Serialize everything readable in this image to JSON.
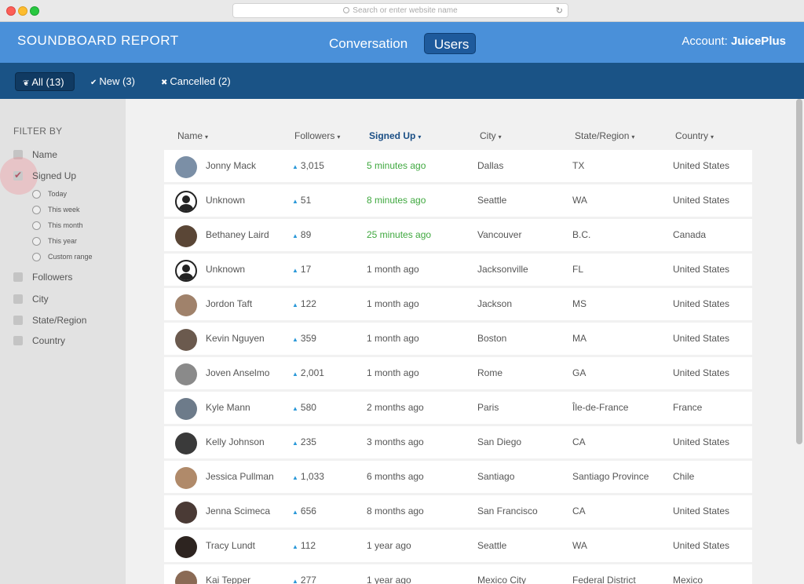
{
  "browser": {
    "url_placeholder": "Search or enter website name"
  },
  "app": {
    "logo": "SOUNDBOARD REPORT",
    "nav": {
      "conversation": "Conversation",
      "users": "Users"
    },
    "account_prefix": "Account:",
    "account_name": "JuicePlus"
  },
  "subnav": {
    "all": "All (13)",
    "new": "New (3)",
    "cancelled": "Cancelled (2)"
  },
  "sidebar": {
    "title": "FILTER BY",
    "filters": {
      "name": "Name",
      "signed_up": "Signed Up",
      "followers": "Followers",
      "city": "City",
      "state": "State/Region",
      "country": "Country"
    },
    "signed_up_options": [
      "Today",
      "This week",
      "This month",
      "This year",
      "Custom range"
    ]
  },
  "table": {
    "headers": {
      "name": "Name",
      "followers": "Followers",
      "signed_up": "Signed Up",
      "city": "City",
      "state": "State/Region",
      "country": "Country"
    },
    "rows": [
      {
        "name": "Jonny Mack",
        "followers": "3,015",
        "signed_up": "5 minutes ago",
        "city": "Dallas",
        "state": "TX",
        "country": "United States"
      },
      {
        "name": "Unknown",
        "followers": "51",
        "signed_up": "8 minutes ago",
        "city": "Seattle",
        "state": "WA",
        "country": "United States"
      },
      {
        "name": "Bethaney Laird",
        "followers": "89",
        "signed_up": "25 minutes ago",
        "city": "Vancouver",
        "state": "B.C.",
        "country": "Canada"
      },
      {
        "name": "Unknown",
        "followers": "17",
        "signed_up": "1 month ago",
        "city": "Jacksonville",
        "state": "FL",
        "country": "United States"
      },
      {
        "name": "Jordon Taft",
        "followers": "122",
        "signed_up": "1 month ago",
        "city": "Jackson",
        "state": "MS",
        "country": "United States"
      },
      {
        "name": "Kevin Nguyen",
        "followers": "359",
        "signed_up": "1 month ago",
        "city": "Boston",
        "state": "MA",
        "country": "United States"
      },
      {
        "name": "Joven Anselmo",
        "followers": "2,001",
        "signed_up": "1 month ago",
        "city": "Rome",
        "state": "GA",
        "country": "United States"
      },
      {
        "name": "Kyle Mann",
        "followers": "580",
        "signed_up": "2 months ago",
        "city": "Paris",
        "state": "Île-de-France",
        "country": "France"
      },
      {
        "name": "Kelly Johnson",
        "followers": "235",
        "signed_up": "3 months ago",
        "city": "San Diego",
        "state": "CA",
        "country": "United States"
      },
      {
        "name": "Jessica Pullman",
        "followers": "1,033",
        "signed_up": "6 months ago",
        "city": "Santiago",
        "state": "Santiago Province",
        "country": "Chile"
      },
      {
        "name": "Jenna Scimeca",
        "followers": "656",
        "signed_up": "8 months ago",
        "city": "San Francisco",
        "state": "CA",
        "country": "United States"
      },
      {
        "name": "Tracy Lundt",
        "followers": "112",
        "signed_up": "1 year ago",
        "city": "Seattle",
        "state": "WA",
        "country": "United States"
      },
      {
        "name": "Kai Tepper",
        "followers": "277",
        "signed_up": "1 year ago",
        "city": "Mexico City",
        "state": "Federal District",
        "country": "Mexico"
      }
    ]
  },
  "colors": {
    "header_blue": "#4a90d9",
    "subbar_navy": "#1a5386",
    "recent_green": "#3fa83f",
    "twitter_blue": "#2a98d8"
  }
}
